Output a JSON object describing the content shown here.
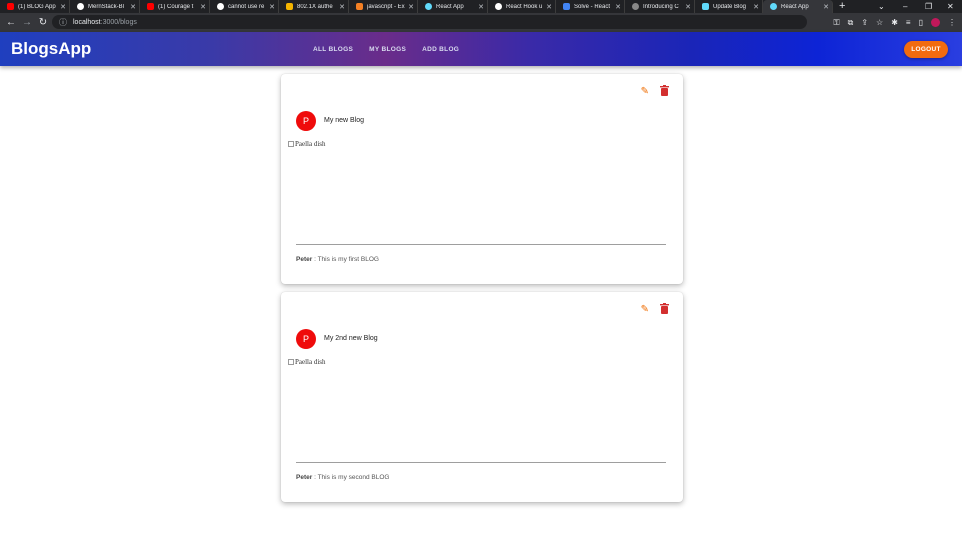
{
  "browser": {
    "tabs": [
      {
        "title": "(1) BLOG App",
        "color": "#ff0000"
      },
      {
        "title": "MernStack-Bl",
        "color": "#ffffff"
      },
      {
        "title": "(1) Courage t",
        "color": "#ff0000"
      },
      {
        "title": "cannot use re",
        "color": "#ffffff"
      },
      {
        "title": "802.1X authe",
        "color": "#f4b400"
      },
      {
        "title": "javascript - Ex",
        "color": "#f48024"
      },
      {
        "title": "React App",
        "color": "#61dafb"
      },
      {
        "title": "React Hook u",
        "color": "#ffffff"
      },
      {
        "title": "Solve - React",
        "color": "#4285f4"
      },
      {
        "title": "Introducing C",
        "color": "#888888"
      },
      {
        "title": "Update Blog",
        "color": "#61dafb"
      },
      {
        "title": "React App",
        "color": "#61dafb",
        "active": true
      }
    ],
    "new_tab_label": "+",
    "url_host": "localhost",
    "url_path": ":3000/blogs"
  },
  "app": {
    "brand": "BlogsApp",
    "nav": [
      "ALL BLOGS",
      "MY BLOGS",
      "ADD BLOG"
    ],
    "logout_label": "LOGOUT",
    "accent": "#f26b0f"
  },
  "blogs": [
    {
      "avatar_letter": "P",
      "title": "My new Blog",
      "image_alt": "Paella dish",
      "author": "Peter",
      "separator": " : ",
      "description": "This is my first BLOG"
    },
    {
      "avatar_letter": "P",
      "title": "My 2nd new Blog",
      "image_alt": "Paella dish",
      "author": "Peter",
      "separator": " : ",
      "description": "This is my second BLOG"
    }
  ],
  "icons": {
    "edit": "pencil-icon",
    "delete": "trash-icon"
  }
}
